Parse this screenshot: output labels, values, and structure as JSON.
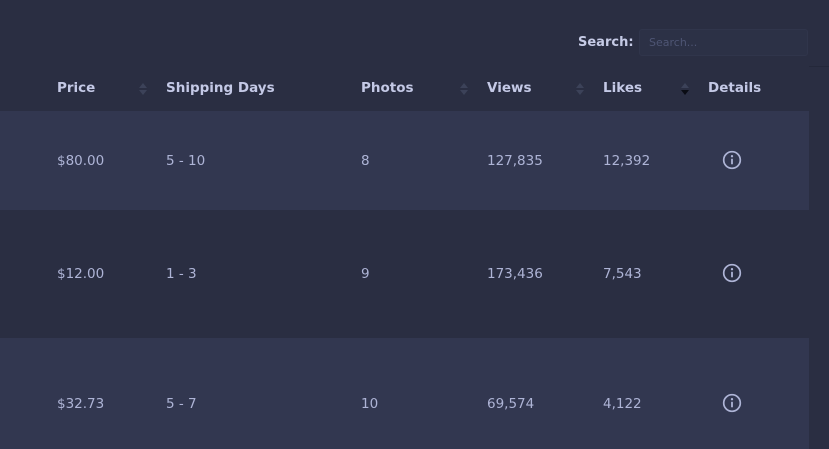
{
  "search": {
    "label": "Search:",
    "placeholder": "Search..."
  },
  "columns": [
    {
      "label": "Price",
      "sort": "none"
    },
    {
      "label": "Shipping Days",
      "sort": "none"
    },
    {
      "label": "Photos",
      "sort": "none"
    },
    {
      "label": "Views",
      "sort": "none"
    },
    {
      "label": "Likes",
      "sort": "descending"
    },
    {
      "label": "Details",
      "sort": "none"
    }
  ],
  "rows": [
    {
      "price": "$80.00",
      "shipping": "5 - 10",
      "photos": "8",
      "views": "127,835",
      "likes": "12,392",
      "details_icon": "info-icon"
    },
    {
      "price": "$12.00",
      "shipping": "1 - 3",
      "photos": "9",
      "views": "173,436",
      "likes": "7,543",
      "details_icon": "info-icon"
    },
    {
      "price": "$32.73",
      "shipping": "5 - 7",
      "photos": "10",
      "views": "69,574",
      "likes": "4,122",
      "details_icon": "info-icon"
    }
  ],
  "colors": {
    "background": "#2a2e42",
    "row_alt": "#323750",
    "header_text": "#c4c9e6",
    "cell_text": "#aeb4d6",
    "sort_inactive": "#3c4259",
    "sort_active": "#0a0c14"
  }
}
